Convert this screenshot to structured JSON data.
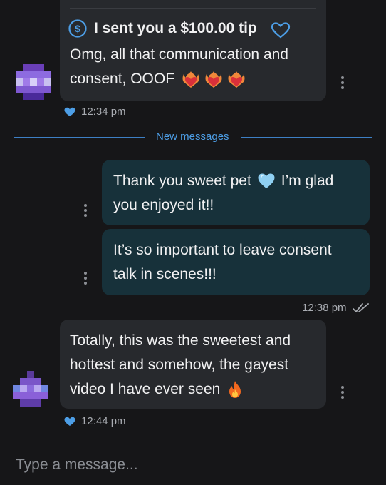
{
  "conversation": {
    "msg1": {
      "tip_text": "I sent you a $100.00 tip",
      "tip_icon": "dollar-circle-icon",
      "line1": "Omg, all that communication and",
      "line2": "consent, OOOF",
      "time": "12:34 pm"
    },
    "divider_label": "New messages",
    "msg2": {
      "line1": "Thank you sweet pet",
      "line1b": "I’m glad",
      "line2": "you enjoyed it!!"
    },
    "msg3": {
      "line1": "It’s so important to leave consent",
      "line2": "talk in scenes!!!",
      "time": "12:38 pm"
    },
    "msg4": {
      "line1": "Totally, this was the sweetest and",
      "line2": "hottest and somehow, the gayest",
      "line3": "video I have ever seen",
      "time": "12:44 pm"
    }
  },
  "composer": {
    "placeholder": "Type a message..."
  },
  "colors": {
    "accent": "#4d9ee6",
    "bubble_in": "#27292d",
    "bubble_out": "#17313a",
    "background": "#161618"
  }
}
